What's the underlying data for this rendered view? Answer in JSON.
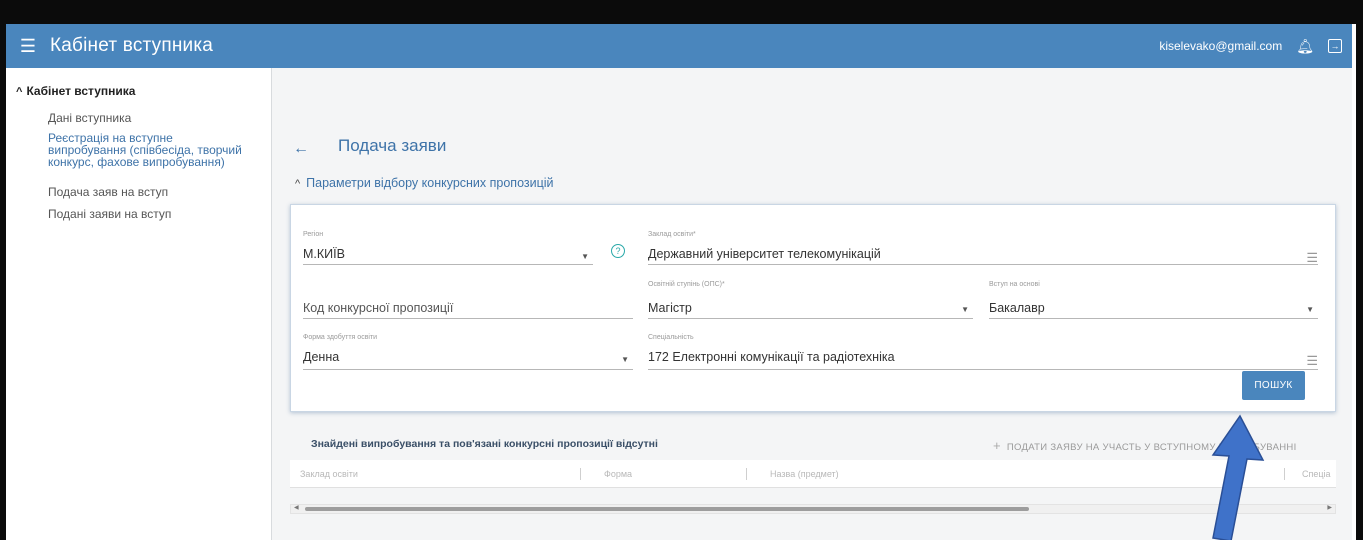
{
  "app": {
    "title": "Кабінет вступника",
    "user_email": "kiselevako@gmail.com"
  },
  "sidebar": {
    "header": "Кабінет вступника",
    "items": [
      {
        "label": "Дані вступника",
        "active": false
      },
      {
        "label_lines": [
          "Реєстрація на вступне",
          "випробування (співбесіда, творчий",
          "конкурс, фахове випробування)"
        ],
        "active": true
      },
      {
        "label": "Подача заяв на вступ",
        "active": false
      },
      {
        "label": "Подані заяви на вступ",
        "active": false
      }
    ]
  },
  "page": {
    "title": "Подача заяви",
    "section": "Параметри відбору конкурсних пропозицій"
  },
  "form": {
    "region": {
      "label": "Регіон",
      "value": "М.КИЇВ"
    },
    "institution": {
      "label": "Заклад освіти*",
      "value": "Державний університет телекомунікацій"
    },
    "offer_code": {
      "placeholder": "Код конкурсної пропозиції"
    },
    "education_level": {
      "label": "Освітній ступінь (ОПС)*",
      "value": "Магістр"
    },
    "entry_basis": {
      "label": "Вступ на основі",
      "value": "Бакалавр"
    },
    "study_form": {
      "label": "Форма здобуття освіти",
      "value": "Денна"
    },
    "specialty": {
      "label": "Спеціальність",
      "value": "172 Електронні комунікації та радіотехніка"
    },
    "search_button": "ПОШУК"
  },
  "results": {
    "message": "Знайдені випробування та пов'язані конкурсні пропозиції відсутні",
    "apply_action": "ПОДАТИ ЗАЯВУ НА УЧАСТЬ У ВСТУПНОМУ ВИПРОБУВАННІ",
    "columns": [
      "Заклад освіти",
      "Форма",
      "Назва (предмет)",
      "Спеціа"
    ]
  },
  "colors": {
    "appbar": "#4a86bd",
    "link": "#3e73a8",
    "help": "#2aa9a9",
    "annotation_arrow": "#3f72c9"
  },
  "icons": [
    "menu-icon",
    "bell-icon",
    "logout-icon",
    "back-arrow-icon",
    "help-icon",
    "list-icon",
    "plus-icon"
  ]
}
